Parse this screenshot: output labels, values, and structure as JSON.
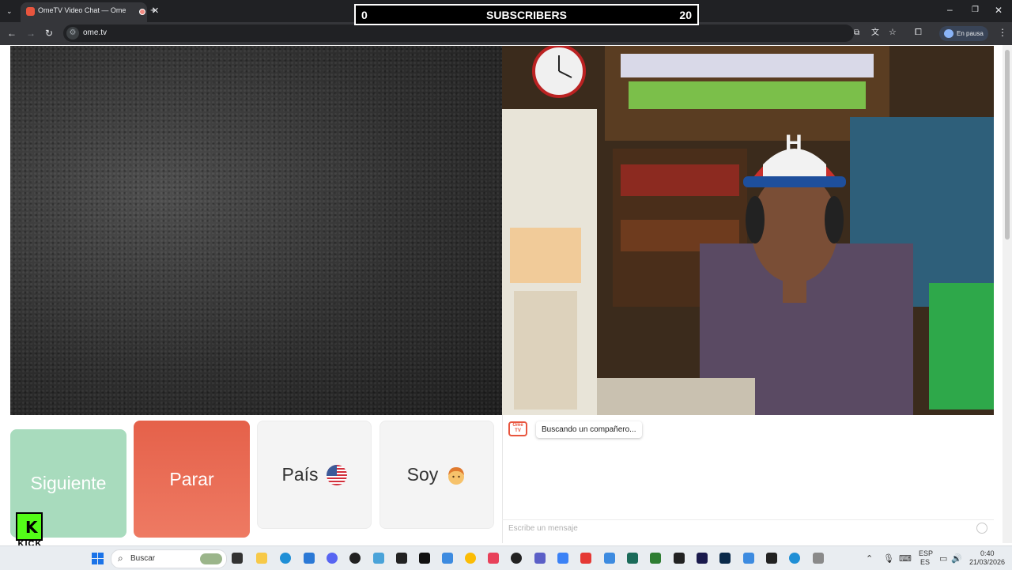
{
  "browser": {
    "tab_title": "OmeTV Video Chat — Ome",
    "url": "ome.tv",
    "profile_status": "En pausa"
  },
  "overlay": {
    "left_count": "0",
    "label": "SUBSCRIBERS",
    "right_count": "20"
  },
  "controls": {
    "next_label": "Siguiente",
    "stop_label": "Parar",
    "country_label": "País",
    "gender_label": "Soy"
  },
  "chat": {
    "logo_text": "Ome TV",
    "status_message": "Buscando un compañero...",
    "input_placeholder": "Escribe un mensaje"
  },
  "streamer": {
    "platform_letter": "K",
    "platform_word": "KICK"
  },
  "taskbar": {
    "search_placeholder": "Buscar",
    "language_line1": "ESP",
    "language_line2": "ES",
    "time": "0:40",
    "date": "21/03/2026"
  },
  "icons": {
    "country_flag": "us-flag-icon",
    "gender": "boy-emoji-icon"
  }
}
